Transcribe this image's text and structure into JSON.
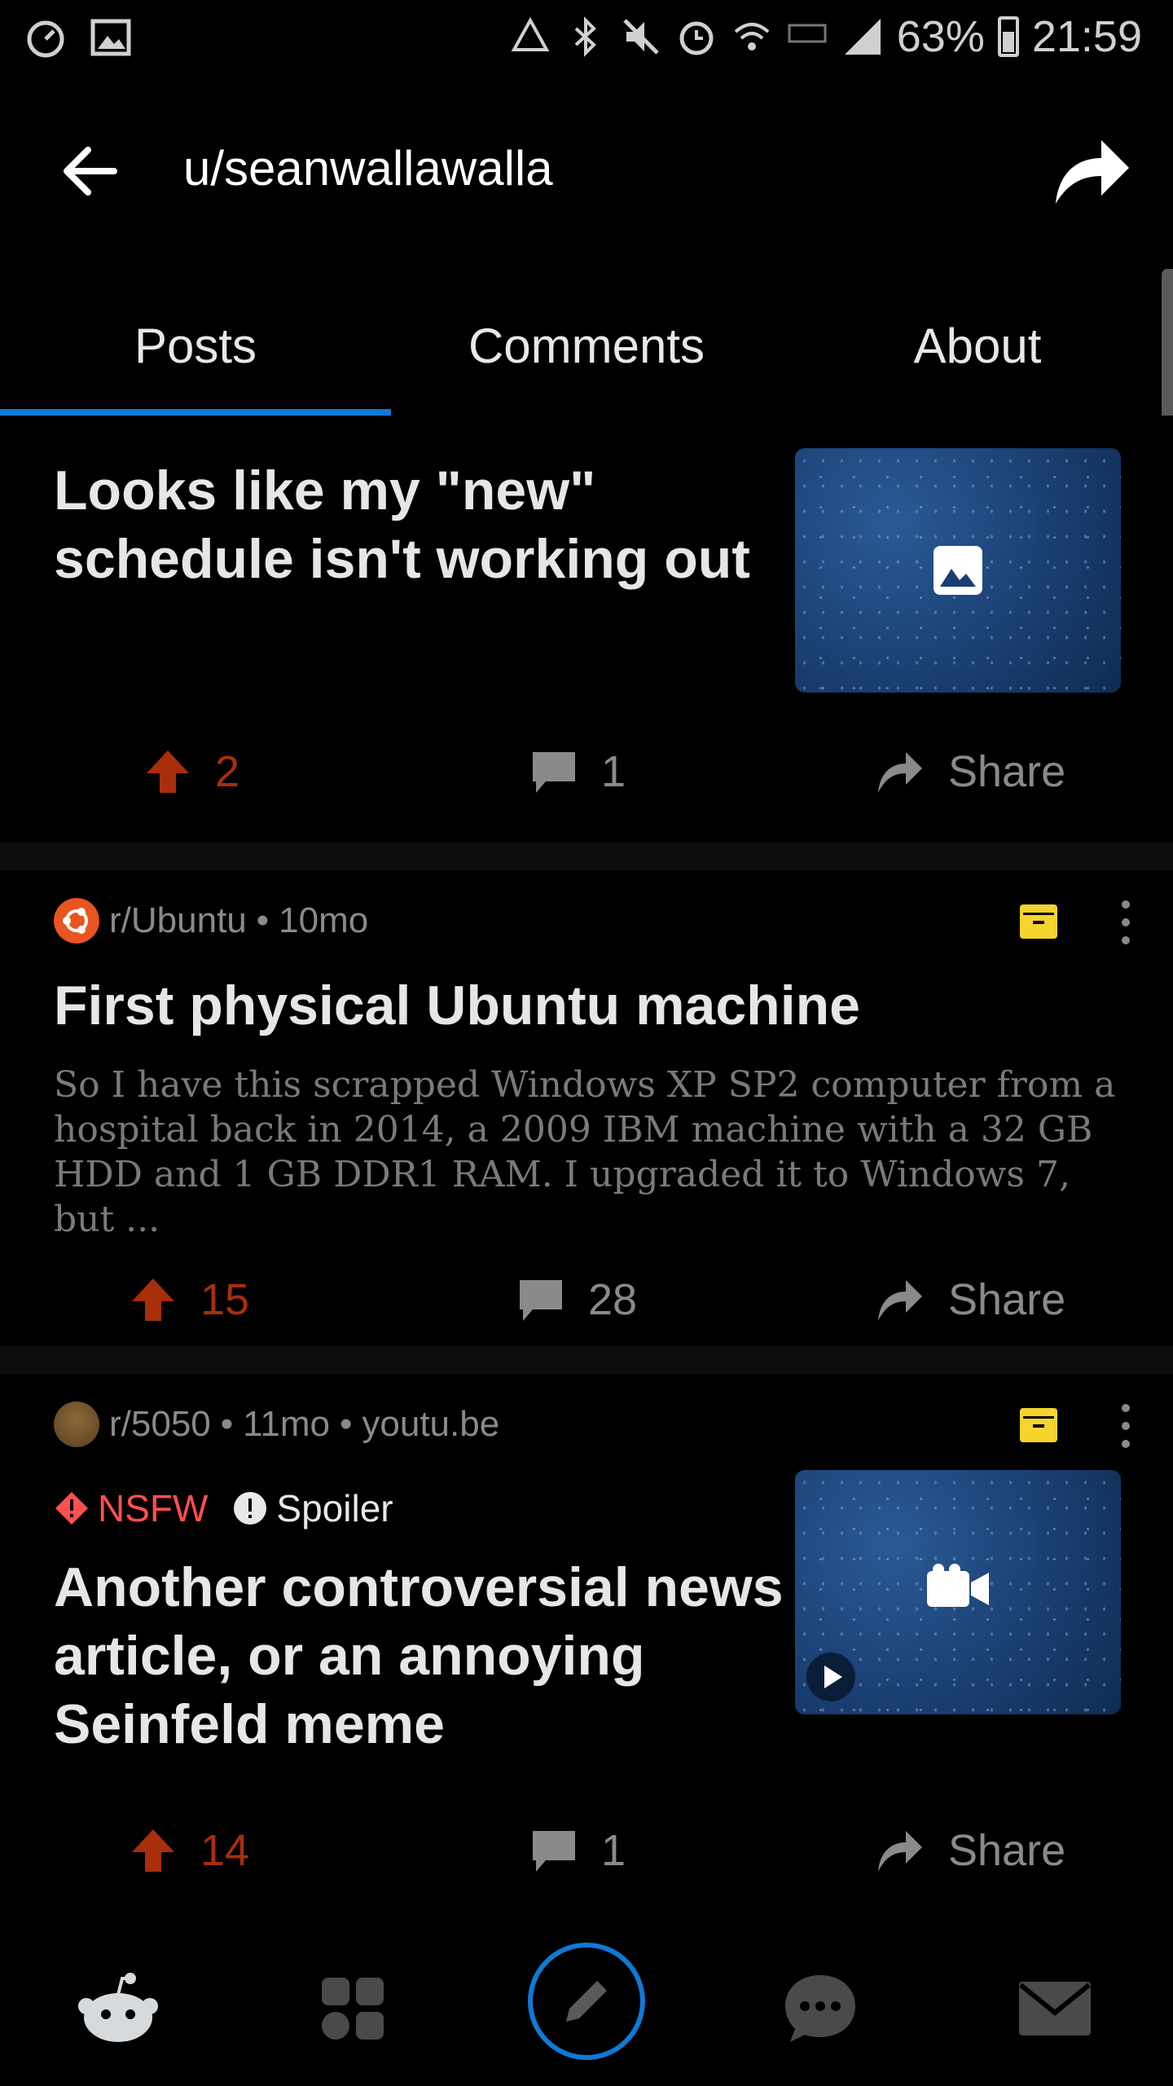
{
  "status_bar": {
    "battery": "63%",
    "time": "21:59",
    "icons": [
      "speed-icon",
      "gallery-icon",
      "recycle-icon",
      "bluetooth-icon",
      "mute-icon",
      "alarm-icon",
      "wifi-icon",
      "lte-icon",
      "signal-icon",
      "battery-icon"
    ]
  },
  "header": {
    "title": "u/seanwallawalla",
    "back_icon": "back-arrow-icon",
    "share_icon": "share-icon"
  },
  "tabs": [
    {
      "label": "Posts",
      "active": true
    },
    {
      "label": "Comments",
      "active": false
    },
    {
      "label": "About",
      "active": false
    }
  ],
  "posts": [
    {
      "title": "Looks like my \"new\" schedule isn't working out",
      "thumbnail": "image-icon",
      "upvotes": "2",
      "comments": "1",
      "share": "Share"
    },
    {
      "subreddit": "r/Ubuntu",
      "age": "10mo",
      "title": "First physical Ubuntu machine",
      "body": "So I have this scrapped Windows XP SP2 computer from a hospital back in 2014, a 2009 IBM machine with a 32 GB HDD and 1 GB DDR1 RAM. I upgraded it to Windows 7, but ...",
      "upvotes": "15",
      "comments": "28",
      "share": "Share"
    },
    {
      "subreddit": "r/5050",
      "age": "11mo",
      "domain": "youtu.be",
      "nsfw": "NSFW",
      "spoiler": "Spoiler",
      "title": "Another controversial news article, or an annoying Seinfeld meme",
      "thumbnail": "video-icon",
      "upvotes": "14",
      "comments": "1",
      "share": "Share"
    }
  ],
  "sep": "•",
  "colors": {
    "accent_blue": "#0f7ad8",
    "upvote": "#a82e0c",
    "archive_yellow": "#f5d42e",
    "nsfw_red": "#ff4f4f",
    "ubuntu_orange": "#e95420"
  },
  "bottom_nav": [
    "home-icon",
    "communities-icon",
    "compose-icon",
    "chat-icon",
    "inbox-icon"
  ]
}
